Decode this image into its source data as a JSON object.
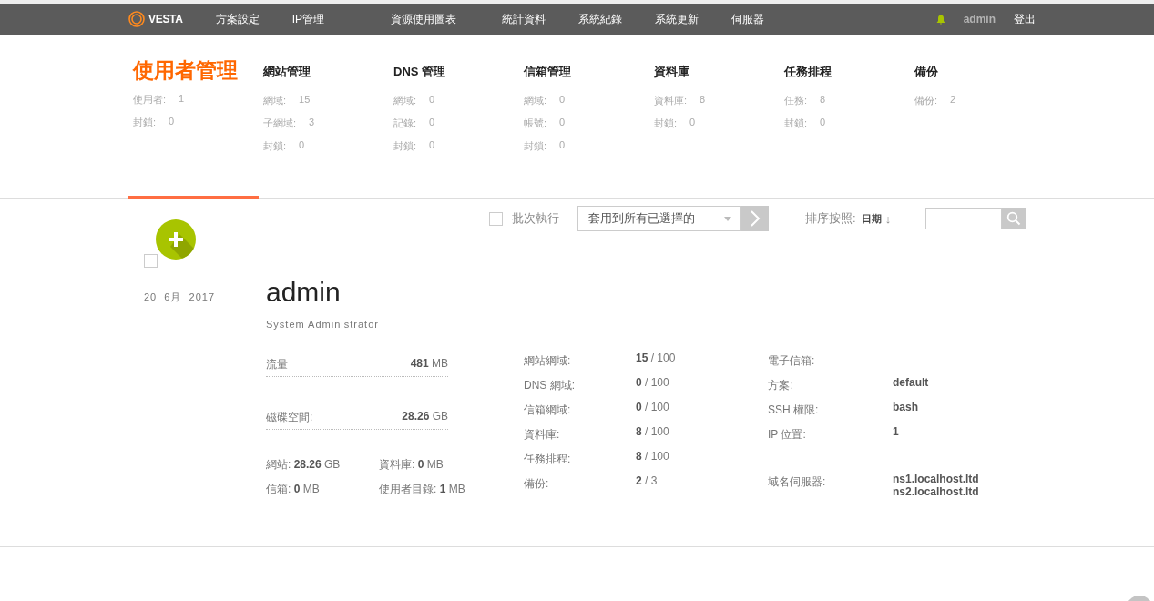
{
  "top_nav": {
    "logo": "VESTA",
    "items": [
      "方案設定",
      "IP管理",
      "資源使用圖表",
      "統計資料",
      "系統紀錄",
      "系統更新",
      "伺服器"
    ],
    "user": "admin",
    "logout": "登出"
  },
  "summary": [
    {
      "title": "使用者管理",
      "selected": true,
      "rows": [
        {
          "label": "使用者:",
          "value": "1"
        },
        {
          "label": "封鎖:",
          "value": "0"
        }
      ]
    },
    {
      "title": "網站管理",
      "selected": false,
      "rows": [
        {
          "label": "網域:",
          "value": "15"
        },
        {
          "label": "子網域:",
          "value": "3"
        },
        {
          "label": "封鎖:",
          "value": "0"
        }
      ]
    },
    {
      "title": "DNS 管理",
      "selected": false,
      "rows": [
        {
          "label": "網域:",
          "value": "0"
        },
        {
          "label": "記錄:",
          "value": "0"
        },
        {
          "label": "封鎖:",
          "value": "0"
        }
      ]
    },
    {
      "title": "信箱管理",
      "selected": false,
      "rows": [
        {
          "label": "網域:",
          "value": "0"
        },
        {
          "label": "帳號:",
          "value": "0"
        },
        {
          "label": "封鎖:",
          "value": "0"
        }
      ]
    },
    {
      "title": "資料庫",
      "selected": false,
      "rows": [
        {
          "label": "資料庫:",
          "value": "8"
        },
        {
          "label": "封鎖:",
          "value": "0"
        }
      ]
    },
    {
      "title": "任務排程",
      "selected": false,
      "rows": [
        {
          "label": "任務:",
          "value": "8"
        },
        {
          "label": "封鎖:",
          "value": "0"
        }
      ]
    },
    {
      "title": "備份",
      "selected": false,
      "rows": [
        {
          "label": "備份:",
          "value": "2"
        }
      ]
    }
  ],
  "toolbar": {
    "batch_label": "批次執行",
    "batch_checked": false,
    "action": "套用到所有已選擇的",
    "sort_label": "排序按照:",
    "sort_value": "日期",
    "sort_arrow": "↓"
  },
  "user": {
    "checked": false,
    "date": "20  6月  2017",
    "name": "admin",
    "role": "System Administrator",
    "usage": [
      {
        "label": "流量",
        "value": "**481** MB"
      },
      {
        "label": "磁碟空間:",
        "value": "**28.26** GB"
      }
    ],
    "disk_detail": [
      "網站: **28.26** GB",
      "資料庫: **0** MB",
      "信箱: **0** MB",
      "使用者目錄: **1** MB"
    ],
    "limits": [
      {
        "label": "網站網域:",
        "value": "**15** / 100"
      },
      {
        "label": "DNS 網域:",
        "value": "**0** / 100"
      },
      {
        "label": "信箱網域:",
        "value": "**0** / 100"
      },
      {
        "label": "資料庫:",
        "value": "**8** / 100"
      },
      {
        "label": "任務排程:",
        "value": "**8** / 100"
      },
      {
        "label": "備份:",
        "value": "**2** / 3"
      }
    ],
    "details": [
      {
        "kind": "single",
        "label": "電子信箱:"
      },
      {
        "kind": "single",
        "label": "方案:",
        "value": "default"
      },
      {
        "kind": "single",
        "label": "SSH 權限:",
        "value": "bash"
      },
      {
        "kind": "single",
        "label": "IP 位置:",
        "value": "1"
      },
      {
        "kind": "list",
        "label": "域名伺服器:",
        "values": [
          "ns1.localhost.ltd",
          "ns2.localhost.ltd"
        ]
      }
    ]
  }
}
